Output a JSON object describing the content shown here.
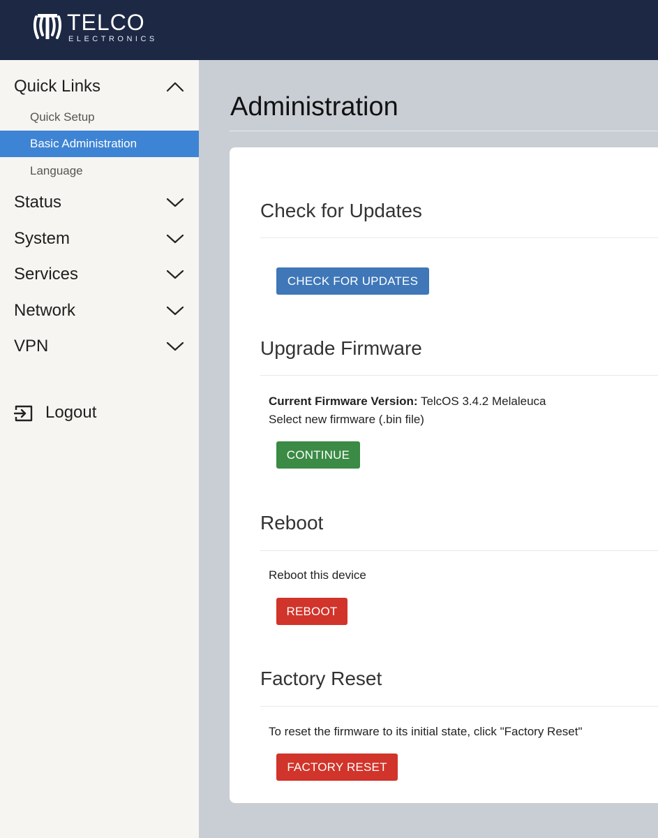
{
  "header": {
    "logo_main": "TELCO",
    "logo_sub": "ELECTRONICS",
    "bg_color": "#1c2844"
  },
  "sidebar": {
    "groups": [
      {
        "label": "Quick Links",
        "chevron": "chevron-up-icon",
        "expanded": true
      },
      {
        "label": "Status",
        "chevron": "chevron-down-icon"
      },
      {
        "label": "System",
        "chevron": "chevron-down-icon"
      },
      {
        "label": "Services",
        "chevron": "chevron-down-icon"
      },
      {
        "label": "Network",
        "chevron": "chevron-down-icon"
      },
      {
        "label": "VPN",
        "chevron": "chevron-down-icon"
      }
    ],
    "quick_links": [
      {
        "label": "Quick Setup"
      },
      {
        "label": "Basic Administration",
        "active": true
      },
      {
        "label": "Language"
      }
    ],
    "logout": {
      "label": "Logout",
      "icon": "logout-icon"
    },
    "active_color": "#3e84d4"
  },
  "main": {
    "title": "Administration",
    "sections": {
      "check_updates": {
        "title": "Check for Updates",
        "button": "CHECK FOR UPDATES"
      },
      "upgrade_firmware": {
        "title": "Upgrade Firmware",
        "version_label": "Current Firmware Version:",
        "version_value": "TelcOS 3.4.2 Melaleuca",
        "select_text": "Select new firmware (.bin file)",
        "button": "CONTINUE"
      },
      "reboot": {
        "title": "Reboot",
        "text": "Reboot this device",
        "button": "REBOOT"
      },
      "factory_reset": {
        "title": "Factory Reset",
        "text": "To reset the firmware to its initial state, click \"Factory Reset\"",
        "button": "FACTORY RESET"
      }
    },
    "colors": {
      "primary": "#3f77b8",
      "success": "#3b8a45",
      "danger": "#d1342a"
    }
  }
}
